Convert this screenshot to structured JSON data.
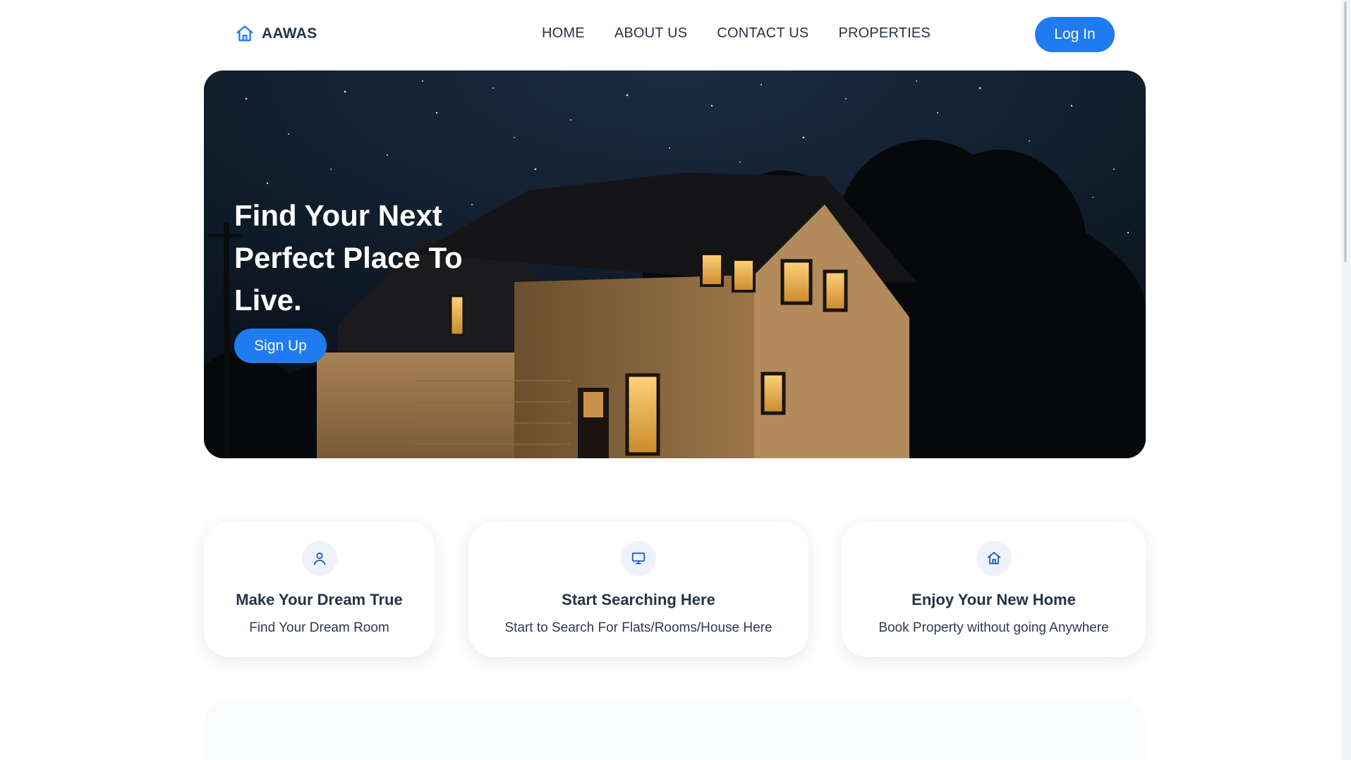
{
  "brand": {
    "name": "AAWAS",
    "icon": "home-icon",
    "accent": "#1f7cf0"
  },
  "nav": {
    "links": [
      {
        "label": "HOME"
      },
      {
        "label": "ABOUT US"
      },
      {
        "label": "CONTACT US"
      },
      {
        "label": "PROPERTIES"
      }
    ],
    "login_label": "Log In"
  },
  "hero": {
    "title": "Find Your Next Perfect Place To Live.",
    "signup_label": "Sign Up"
  },
  "features": [
    {
      "icon": "user-icon",
      "title": "Make Your Dream True",
      "text": "Find Your Dream Room"
    },
    {
      "icon": "monitor-icon",
      "title": "Start Searching Here",
      "text": "Start to Search For Flats/Rooms/House Here"
    },
    {
      "icon": "home-icon",
      "title": "Enjoy Your New Home",
      "text": "Book Property without going Anywhere"
    }
  ]
}
